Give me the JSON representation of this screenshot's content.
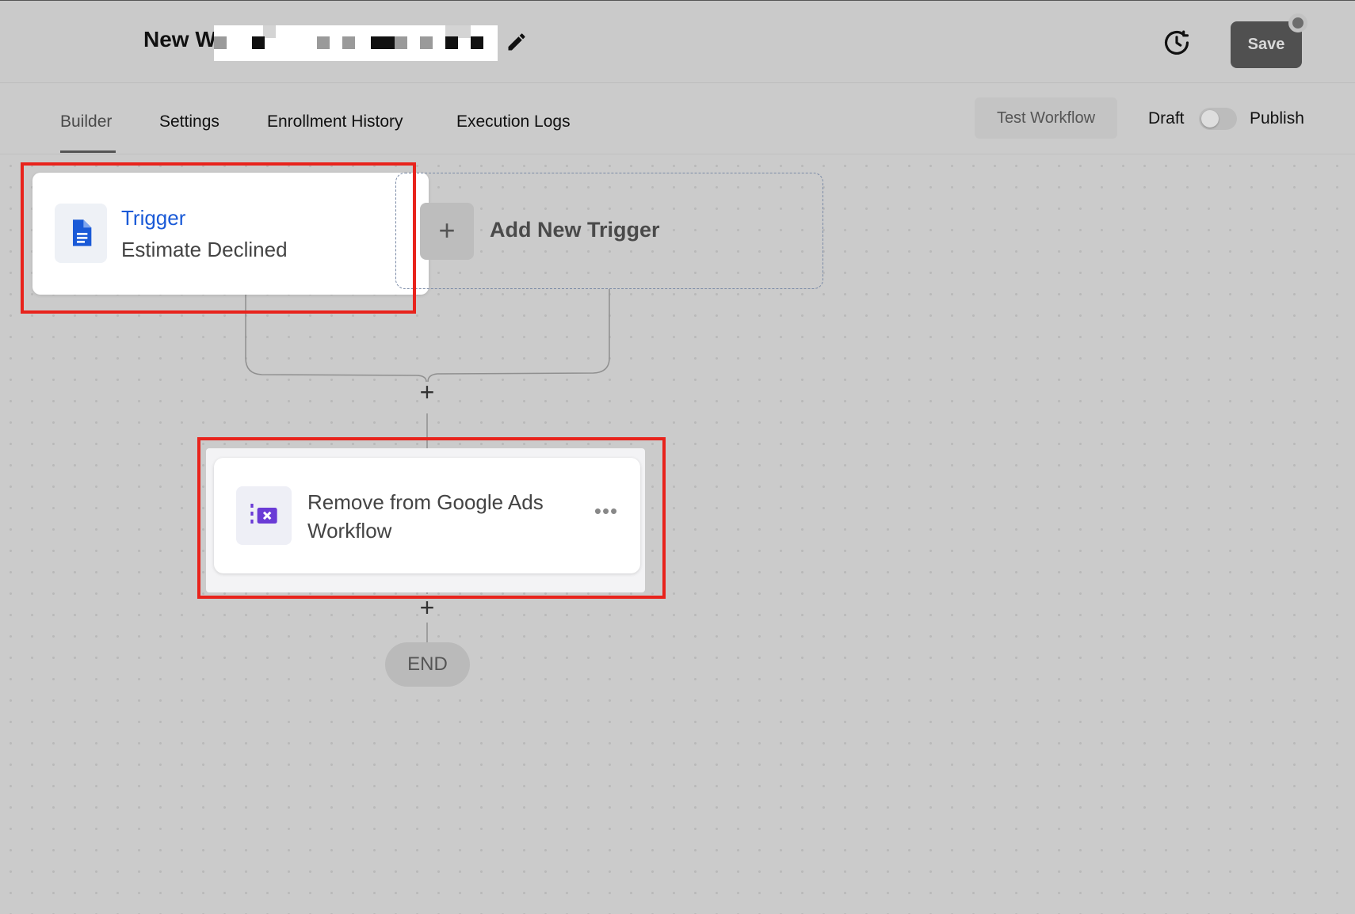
{
  "header": {
    "title": "New W",
    "save_label": "Save"
  },
  "tabs": [
    {
      "label": "Builder",
      "active": true
    },
    {
      "label": "Settings",
      "active": false
    },
    {
      "label": "Enrollment History",
      "active": false
    },
    {
      "label": "Execution Logs",
      "active": false
    }
  ],
  "toolbar": {
    "test_workflow_label": "Test Workflow",
    "draft_label": "Draft",
    "publish_label": "Publish",
    "publish_toggle_on": false
  },
  "workflow": {
    "trigger": {
      "title": "Trigger",
      "subtitle": "Estimate Declined",
      "icon": "document-icon",
      "title_color": "#1a5ad7"
    },
    "add_trigger_label": "Add New Trigger",
    "plus_symbol": "+",
    "action": {
      "label": "Remove from Google Ads Workflow",
      "icon": "remove-from-workflow-icon",
      "icon_color": "#6a3bd6",
      "menu_symbol": "•••"
    },
    "end_label": "END"
  },
  "annotations": {
    "highlight_color": "#e8231c"
  }
}
